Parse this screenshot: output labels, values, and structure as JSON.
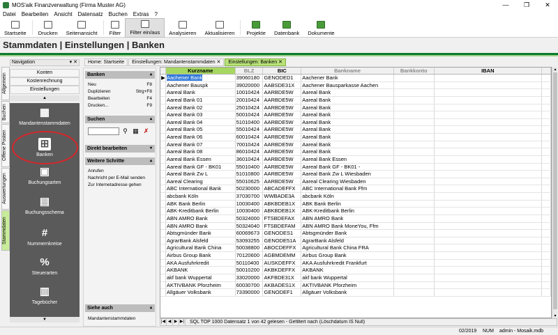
{
  "window": {
    "title": "MOS'aik Finanzverwaltung (Firma Muster AG)",
    "min": "—",
    "max": "❐",
    "close": "✕"
  },
  "menu": [
    "Datei",
    "Bearbeiten",
    "Ansicht",
    "Datensatz",
    "Buchen",
    "Extras",
    "?"
  ],
  "toolbar": [
    "Startseite",
    "Drucken",
    "Seitenansicht",
    "Filter",
    "Filter ein/aus",
    "Analysieren",
    "Aktualisieren",
    "Projekte",
    "Datenbank",
    "Dokumente"
  ],
  "page_title": "Stammdaten | Einstellungen | Banken",
  "navigation": {
    "header": "Navigation",
    "pin": "▾ ✕",
    "vertical_tabs": [
      "Allgemein",
      "Buchen",
      "Offene Posten",
      "Auswertungen",
      "Stammdaten"
    ],
    "sections": [
      "Konten",
      "Kostenrechnung",
      "Einstellungen"
    ],
    "up_arrow": "▲",
    "down_arrow": "▼",
    "items": [
      {
        "label": "Mandantenstammdaten",
        "icon": "▦"
      },
      {
        "label": "Banken",
        "icon": "⊞"
      },
      {
        "label": "Buchungsarten",
        "icon": "▣"
      },
      {
        "label": "Buchungsschema",
        "icon": "▤"
      },
      {
        "label": "Nummernkreise",
        "icon": "#"
      },
      {
        "label": "Steuerarten",
        "icon": "%"
      },
      {
        "label": "Tagebücher",
        "icon": "▥"
      }
    ]
  },
  "tabs": [
    "Home: Startseite",
    "Einstellungen: Mandantenstammdaten ✕",
    "Einstellungen: Banken ✕"
  ],
  "task_panel": {
    "banken_header": "Banken",
    "actions": [
      {
        "label": "Neu",
        "key": "F8"
      },
      {
        "label": "Duplizieren",
        "key": "Strg+F8"
      },
      {
        "label": "Bearbeiten",
        "key": "F4"
      },
      {
        "label": "Drucken...",
        "key": "F9"
      }
    ],
    "suchen_header": "Suchen",
    "direkt_header": "Direkt bearbeiten",
    "weitere_header": "Weitere Schritte",
    "weitere": [
      "Anrufen",
      "Nachricht per E-Mail senden",
      "Zur Internetadresse gehen"
    ],
    "siehe_header": "Siehe auch",
    "siehe": [
      "Mandantenstammdaten"
    ],
    "collapse": "▴",
    "expand": "▾"
  },
  "grid": {
    "columns": [
      "Kurzname",
      "BLZ",
      "BIC",
      "Bankname",
      "Bankkonto",
      "IBAN"
    ],
    "current_marker": "▶",
    "rows": [
      [
        "Aachener Bank",
        "39060180",
        "GENODED1",
        "Aachener Bank"
      ],
      [
        "Aachener Bauspk",
        "39020000",
        "AABSDE31X",
        "Aachener Bausparkasse Aachen"
      ],
      [
        "Aareal Bank",
        "10010424",
        "AARBDE5W",
        "Aareal Bank"
      ],
      [
        "Aareal Bank 01",
        "20010424",
        "AARBDE5W",
        "Aareal Bank"
      ],
      [
        "Aareal Bank 02",
        "25010424",
        "AARBDE5W",
        "Aareal Bank"
      ],
      [
        "Aareal Bank 03",
        "50010424",
        "AARBDE5W",
        "Aareal Bank"
      ],
      [
        "Aareal Bank 04",
        "51010400",
        "AARBDE5W",
        "Aareal Bank"
      ],
      [
        "Aareal Bank 05",
        "55010424",
        "AARBDE5W",
        "Aareal Bank"
      ],
      [
        "Aareal Bank 06",
        "60010424",
        "AARBDE5W",
        "Aareal Bank"
      ],
      [
        "Aareal Bank 07",
        "70010424",
        "AARBDE5W",
        "Aareal Bank"
      ],
      [
        "Aareal Bank 08",
        "86010424",
        "AARBDE5W",
        "Aareal Bank"
      ],
      [
        "Aareal Bank Essen",
        "36010424",
        "AARBDE5W",
        "Aareal Bank Essen"
      ],
      [
        "Aareal Bank GF - BK01",
        "55010400",
        "AARBDE5W",
        "Aareal Bank GF - BK01 -"
      ],
      [
        "Aareal Bank Zw L",
        "51010800",
        "AARBDE5W",
        "Aareal Bank Zw L Wiesbaden"
      ],
      [
        "Aareal Clearing",
        "55010625",
        "AARBDE5W",
        "Aareal Clearing Wiesbaden"
      ],
      [
        "ABC International Bank",
        "50230000",
        "ABCADEFFX",
        "ABC International Bank Ffm"
      ],
      [
        "abcbank Köln",
        "37030700",
        "WWBADE3A",
        "abcbank Köln"
      ],
      [
        "ABK Bank Berlin",
        "10030400",
        "ABKBDEB1X",
        "ABK Bank Berlin"
      ],
      [
        "ABK-Kreditbank Berlin",
        "10030400",
        "ABKBDEB1X",
        "ABK-Kreditbank Berlin"
      ],
      [
        "ABN AMRO Bank",
        "50324000",
        "FTSBDEFAX",
        "ABN AMRO Bank"
      ],
      [
        "ABN AMRO Bank",
        "50324040",
        "FTSBDEFAM",
        "ABN AMRO Bank MoneYou, Ffm"
      ],
      [
        "Abtsgmünder Bank",
        "60069673",
        "GENODES1",
        "Abtsgmünder Bank"
      ],
      [
        "AgrarBank Alsfeld",
        "53093255",
        "GENODE51A",
        "AgrarBank Alsfeld"
      ],
      [
        "Agricultural Bank China",
        "50038800",
        "ABOCDEFFX",
        "Agricultural Bank China FRA"
      ],
      [
        "Airbus Group Bank",
        "70120600",
        "AGBMDEMM",
        "Airbus Group Bank"
      ],
      [
        "AKA Ausfuhrkredit",
        "50110400",
        "AUSKDEFFX",
        "AKA Ausfuhrkredit Frankfurt"
      ],
      [
        "AKBANK",
        "50010200",
        "AKBKDEFFX",
        "AKBANK"
      ],
      [
        "akf bank Wuppertal",
        "33020000",
        "AKFBDE31X",
        "akf bank Wuppertal"
      ],
      [
        "AKTIVBANK Pforzheim",
        "60030700",
        "AKBADES1X",
        "AKTIVBANK Pforzheim"
      ],
      [
        "Allgäuer Volksbank",
        "73390000",
        "GENODEF1",
        "Allgäuer Volksbank"
      ]
    ]
  },
  "footer": {
    "nav": [
      "|◀",
      "◀",
      "▶",
      "▶|"
    ],
    "text": "SQL TOP 1000 Datensatz 1 von 42 gelesen - Gefiltert nach (Löschdatum IS Null)"
  },
  "status": {
    "period": "02/2019",
    "numlock": "NUM",
    "user": "admin - Mosaik.mdb"
  }
}
